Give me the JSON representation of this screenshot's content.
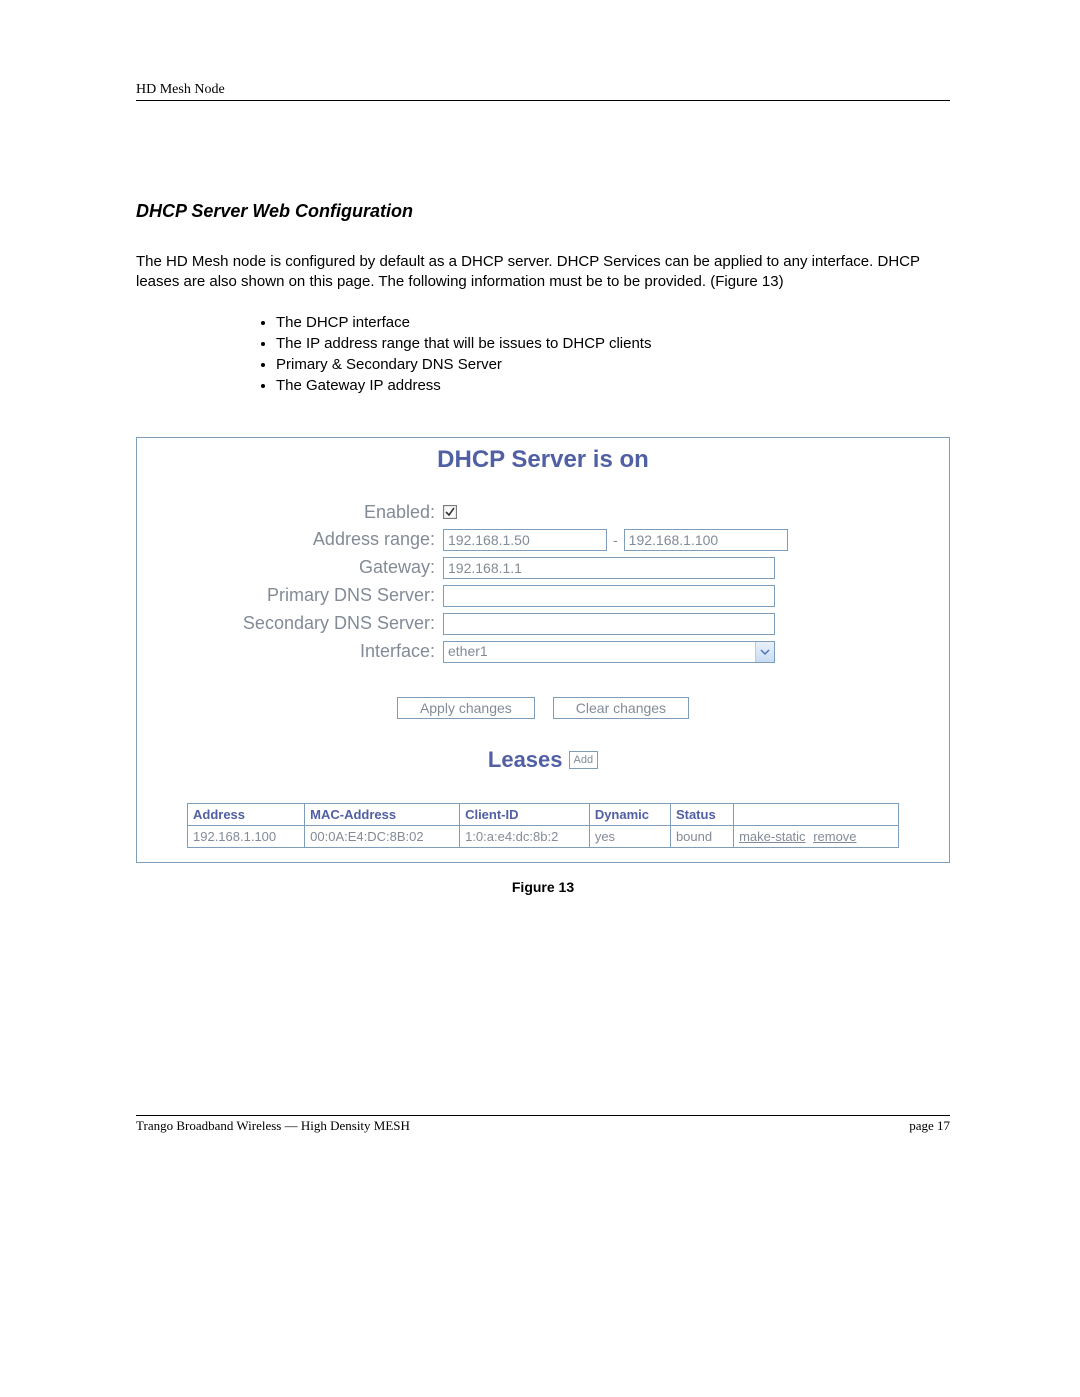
{
  "doc": {
    "header": "HD Mesh Node",
    "section_title": "DHCP Server Web Configuration",
    "intro": "The HD Mesh node is configured by default as a DHCP server. DHCP Services can be applied to any interface. DHCP leases are also shown on this page. The following information must be to be provided. (Figure 13)",
    "bullets": [
      "The DHCP interface",
      "The IP address range that will be issues to DHCP clients",
      "Primary & Secondary DNS Server",
      "The Gateway IP address"
    ],
    "figure_caption": "Figure 13",
    "footer_left": "Trango Broadband Wireless — High Density MESH",
    "footer_right": "page 17"
  },
  "panel": {
    "title": "DHCP Server is on",
    "labels": {
      "enabled": "Enabled:",
      "address_range": "Address range:",
      "gateway": "Gateway:",
      "primary_dns": "Primary DNS Server:",
      "secondary_dns": "Secondary DNS Server:",
      "interface": "Interface:"
    },
    "values": {
      "enabled_checked": true,
      "range_start": "192.168.1.50",
      "range_sep": "-",
      "range_end": "192.168.1.100",
      "gateway": "192.168.1.1",
      "primary_dns": "",
      "secondary_dns": "",
      "interface": "ether1"
    },
    "buttons": {
      "apply": "Apply changes",
      "clear": "Clear changes"
    }
  },
  "leases": {
    "title": "Leases",
    "add_btn": "Add",
    "columns": [
      "Address",
      "MAC-Address",
      "Client-ID",
      "Dynamic",
      "Status",
      ""
    ],
    "rows": [
      {
        "address": "192.168.1.100",
        "mac": "00:0A:E4:DC:8B:02",
        "client_id": "1:0:a:e4:dc:8b:2",
        "dynamic": "yes",
        "status": "bound",
        "actions": {
          "make_static": "make-static",
          "remove": "remove"
        }
      }
    ]
  }
}
